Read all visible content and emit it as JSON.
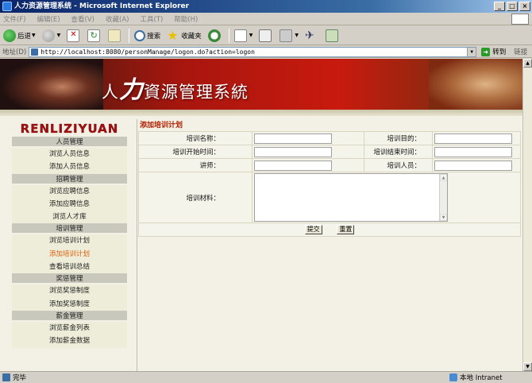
{
  "window": {
    "title": "人力资源管理系统 - Microsoft Internet Explorer",
    "controls": [
      "_",
      "□",
      "×"
    ]
  },
  "menubar": [
    "文件(F)",
    "编辑(E)",
    "查看(V)",
    "收藏(A)",
    "工具(T)",
    "帮助(H)"
  ],
  "toolbar": {
    "back_label": "后退",
    "search_label": "搜索",
    "favorites_label": "收藏夹"
  },
  "addressbar": {
    "label": "地址(D)",
    "url": "http://localhost:8080/personManage/logon.do?action=logon",
    "go_label": "转到",
    "links_label": "链接"
  },
  "banner": {
    "title_pre": "人",
    "title_big": "力",
    "title_post": "資源管理系統"
  },
  "sidebar": {
    "brand": "RENLIZIYUAN",
    "groups": [
      {
        "header": "人员管理",
        "items": [
          "浏览人员信息",
          "添加人员信息"
        ]
      },
      {
        "header": "招聘管理",
        "items": [
          "浏览应聘信息",
          "添加应聘信息",
          "浏览人才库"
        ]
      },
      {
        "header": "培训管理",
        "items": [
          "浏览培训计划",
          "添加培训计划",
          "查看培训总结"
        ]
      },
      {
        "header": "奖惩管理",
        "items": [
          "浏览奖惩制度",
          "添加奖惩制度"
        ]
      },
      {
        "header": "薪金管理",
        "items": [
          "浏览薪金列表",
          "添加薪金数据"
        ]
      }
    ],
    "active_item": "添加培训计划"
  },
  "form": {
    "title": "添加培训计划",
    "name_label": "培训名称：",
    "name_value": "",
    "purpose_label": "培训目的：",
    "purpose_value": "",
    "start_label": "培训开始时间：",
    "start_value": "",
    "end_label": "培训结束时间：",
    "end_value": "",
    "teacher_label": "讲师：",
    "teacher_value": "",
    "trainees_label": "培训人员：",
    "trainees_value": "",
    "materials_label": "培训材料：",
    "materials_value": "",
    "submit_label": "提交",
    "reset_label": "重置"
  },
  "statusbar": {
    "status": "完毕",
    "zone": "本地 Intranet"
  }
}
